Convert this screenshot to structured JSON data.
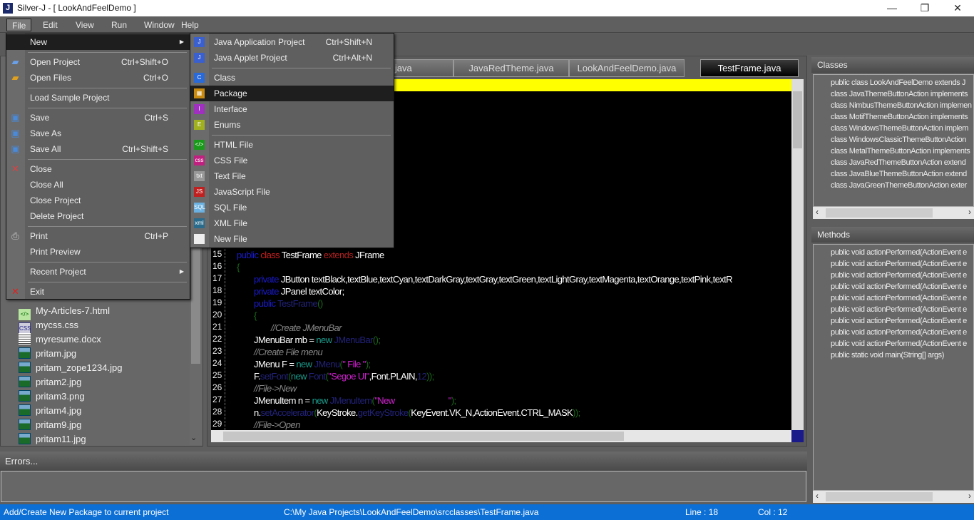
{
  "window": {
    "title": "Silver-J - [ LookAndFeelDemo ]",
    "app_icon": "J",
    "controls": [
      "—",
      "❐",
      "✕"
    ]
  },
  "menubar": [
    "File",
    "Edit",
    "View",
    "Run",
    "Window",
    "Help"
  ],
  "file_menu": [
    {
      "label": "New",
      "shortcut": "",
      "submenu": true,
      "icon": "none"
    },
    {
      "sep": true
    },
    {
      "label": "Open Project",
      "shortcut": "Ctrl+Shift+O",
      "icon": "folder-open-icon"
    },
    {
      "label": "Open Files",
      "shortcut": "Ctrl+O",
      "icon": "folder-icon"
    },
    {
      "sep": true
    },
    {
      "label": "Load Sample Project",
      "shortcut": ""
    },
    {
      "sep": true
    },
    {
      "label": "Save",
      "shortcut": "Ctrl+S",
      "icon": "save-icon"
    },
    {
      "label": "Save As",
      "shortcut": "",
      "icon": "save-as-icon"
    },
    {
      "label": "Save All",
      "shortcut": "Ctrl+Shift+S",
      "icon": "save-all-icon"
    },
    {
      "sep": true
    },
    {
      "label": "Close",
      "shortcut": "",
      "icon": "close-file-icon"
    },
    {
      "label": "Close All",
      "shortcut": ""
    },
    {
      "label": "Close Project",
      "shortcut": ""
    },
    {
      "label": "Delete Project",
      "shortcut": ""
    },
    {
      "sep": true
    },
    {
      "label": "Print",
      "shortcut": "Ctrl+P",
      "icon": "printer-icon"
    },
    {
      "label": "Print Preview",
      "shortcut": ""
    },
    {
      "sep": true
    },
    {
      "label": "Recent Project",
      "shortcut": "",
      "submenu": true
    },
    {
      "sep": true
    },
    {
      "label": "Exit",
      "shortcut": "",
      "icon": "exit-icon"
    }
  ],
  "new_submenu": [
    {
      "label": "Java Application Project",
      "shortcut": "Ctrl+Shift+N",
      "icon": "java-project-icon",
      "glyph": "J",
      "color": "#3a5fcf"
    },
    {
      "label": "Java Applet Project",
      "shortcut": "Ctrl+Alt+N",
      "icon": "java-applet-icon",
      "glyph": "J",
      "color": "#3a5fcf"
    },
    {
      "sep": true
    },
    {
      "label": "Class",
      "shortcut": "",
      "icon": "class-icon",
      "glyph": "C",
      "color": "#2a6ad8"
    },
    {
      "label": "Package",
      "shortcut": "",
      "icon": "package-icon",
      "glyph": "▦",
      "color": "#c88a10",
      "highlighted": true
    },
    {
      "label": "Interface",
      "shortcut": "",
      "icon": "interface-icon",
      "glyph": "I",
      "color": "#a030c0"
    },
    {
      "label": "Enums",
      "shortcut": "",
      "icon": "enum-icon",
      "glyph": "E",
      "color": "#a0b020"
    },
    {
      "sep": true
    },
    {
      "label": "HTML File",
      "shortcut": "",
      "icon": "html-file-icon",
      "glyph": "</>",
      "color": "#1a9a1a"
    },
    {
      "label": "CSS File",
      "shortcut": "",
      "icon": "css-file-icon",
      "glyph": "css",
      "color": "#c02080"
    },
    {
      "label": "Text File",
      "shortcut": "",
      "icon": "text-file-icon",
      "glyph": "txt",
      "color": "#999"
    },
    {
      "label": "JavaScript File",
      "shortcut": "",
      "icon": "js-file-icon",
      "glyph": "JS",
      "color": "#c02020"
    },
    {
      "label": "SQL File",
      "shortcut": "",
      "icon": "sql-file-icon",
      "glyph": "SQL",
      "color": "#6ab0e0"
    },
    {
      "label": "XML File",
      "shortcut": "",
      "icon": "xml-file-icon",
      "glyph": "xml",
      "color": "#2a6a8a"
    },
    {
      "label": "New File",
      "shortcut": "",
      "icon": "new-file-icon",
      "glyph": "",
      "color": "#eee"
    }
  ],
  "tree": [
    {
      "name": "My-Articles-7.html",
      "type": "html"
    },
    {
      "name": "mycss.css",
      "type": "css"
    },
    {
      "name": "myresume.docx",
      "type": "doc"
    },
    {
      "name": "pritam.jpg",
      "type": "img"
    },
    {
      "name": "pritam_zope1234.jpg",
      "type": "img"
    },
    {
      "name": "pritam2.jpg",
      "type": "img"
    },
    {
      "name": "pritam3.png",
      "type": "img"
    },
    {
      "name": "pritam4.jpg",
      "type": "img"
    },
    {
      "name": "pritam9.jpg",
      "type": "img"
    },
    {
      "name": "pritam11.jpg",
      "type": "img"
    }
  ],
  "tabs": [
    {
      "label": "me.java"
    },
    {
      "label": "JavaRedTheme.java"
    },
    {
      "label": "LookAndFeelDemo.java"
    },
    {
      "label": "TestFrame.java",
      "active": true
    }
  ],
  "code": [
    {
      "n": "15",
      "indent": 0,
      "tokens": [
        [
          "public ",
          "#1a1acc"
        ],
        [
          "class ",
          "#cc2020"
        ],
        [
          "TestFrame ",
          "#fff"
        ],
        [
          "extends ",
          "#b02020"
        ],
        [
          "JFrame",
          "#fff"
        ]
      ]
    },
    {
      "n": "16",
      "indent": 0,
      "tokens": [
        [
          "{",
          "#1a6a1a"
        ]
      ]
    },
    {
      "n": "17",
      "indent": 1,
      "tokens": [
        [
          "private ",
          "#1a1acc"
        ],
        [
          "JButton textBlack,textBlue,textCyan,textDarkGray,textGray,textGreen,textLightGray,textMagenta,textOrange,textPink,textR",
          "#fff"
        ]
      ]
    },
    {
      "n": "18",
      "indent": 1,
      "tokens": [
        [
          "private ",
          "#1a1acc"
        ],
        [
          "JPanel textColor;",
          "#fff"
        ]
      ]
    },
    {
      "n": "19",
      "indent": 1,
      "tokens": [
        [
          "public ",
          "#1a1acc"
        ],
        [
          "TestFrame",
          "#22227a"
        ],
        [
          "()",
          "#1a6a1a"
        ]
      ]
    },
    {
      "n": "20",
      "indent": 1,
      "tokens": [
        [
          "{",
          "#1a6a1a"
        ]
      ]
    },
    {
      "n": "21",
      "indent": 2,
      "tokens": [
        [
          "//Create JMenuBar",
          "#888",
          "i"
        ]
      ]
    },
    {
      "n": "22",
      "indent": 1,
      "tokens": [
        [
          "JMenuBar mb = ",
          "#fff"
        ],
        [
          "new ",
          "#1a9a8a"
        ],
        [
          "JMenuBar",
          "#22227a"
        ],
        [
          "();",
          "#1a6a1a"
        ]
      ]
    },
    {
      "n": "23",
      "indent": 1,
      "tokens": [
        [
          "//Create File menu",
          "#888",
          "i"
        ]
      ]
    },
    {
      "n": "24",
      "indent": 1,
      "tokens": [
        [
          "JMenu F = ",
          "#fff"
        ],
        [
          "new ",
          "#1a9a8a"
        ],
        [
          "JMenu",
          "#22227a"
        ],
        [
          "(",
          "#1a6a1a"
        ],
        [
          "\" File \"",
          "#d020d0"
        ],
        [
          ");",
          "#1a6a1a"
        ]
      ]
    },
    {
      "n": "25",
      "indent": 1,
      "tokens": [
        [
          "F.",
          "#fff"
        ],
        [
          "setFont",
          "#22227a"
        ],
        [
          "(",
          "#1a6a1a"
        ],
        [
          "new ",
          "#1a9a8a"
        ],
        [
          "Font",
          "#22227a"
        ],
        [
          "(",
          "#1a6a1a"
        ],
        [
          "\"Segoe UI\"",
          "#d020d0"
        ],
        [
          ",Font.PLAIN,",
          "#fff"
        ],
        [
          "12",
          "#22227a"
        ],
        [
          "));",
          "#1a6a1a"
        ]
      ]
    },
    {
      "n": "26",
      "indent": 1,
      "tokens": [
        [
          "//File->New",
          "#888",
          "i"
        ]
      ]
    },
    {
      "n": "27",
      "indent": 1,
      "tokens": [
        [
          "JMenuItem n = ",
          "#fff"
        ],
        [
          "new ",
          "#1a9a8a"
        ],
        [
          "JMenuItem",
          "#22227a"
        ],
        [
          "(",
          "#1a6a1a"
        ],
        [
          "\"New                         \"",
          "#d020d0"
        ],
        [
          ");",
          "#1a6a1a"
        ]
      ]
    },
    {
      "n": "28",
      "indent": 1,
      "tokens": [
        [
          "n.",
          "#fff"
        ],
        [
          "setAccelerator",
          "#22227a"
        ],
        [
          "(",
          "#1a6a1a"
        ],
        [
          "KeyStroke.",
          "#fff"
        ],
        [
          "getKeyStroke",
          "#22227a"
        ],
        [
          "(",
          "#1a6a1a"
        ],
        [
          "KeyEvent.VK_N,ActionEvent.CTRL_MASK",
          "#fff"
        ],
        [
          "));",
          "#1a6a1a"
        ]
      ]
    },
    {
      "n": "29",
      "indent": 1,
      "tokens": [
        [
          "//File->Open",
          "#888",
          "i"
        ]
      ]
    }
  ],
  "classes": {
    "title": "Classes",
    "items": [
      "public class LookAndFeelDemo extends J",
      "class JavaThemeButtonAction implements",
      "class NimbusThemeButtonAction implemen",
      "class MotifThemeButtonAction implements",
      "class WindowsThemeButtonAction implem",
      "class WindowsClassicThemeButtonAction",
      "class MetalThemeButtonAction implements",
      "class JavaRedThemeButtonAction extend",
      "class JavaBlueThemeButtonAction extend",
      "class JavaGreenThemeButtonAction exter"
    ]
  },
  "methods": {
    "title": "Methods",
    "items": [
      "public void actionPerformed(ActionEvent e",
      "public void actionPerformed(ActionEvent e",
      "public void actionPerformed(ActionEvent e",
      "public void actionPerformed(ActionEvent e",
      "public void actionPerformed(ActionEvent e",
      "public void actionPerformed(ActionEvent e",
      "public void actionPerformed(ActionEvent e",
      "public void actionPerformed(ActionEvent e",
      "public void actionPerformed(ActionEvent e",
      "public static void main(String[] args)"
    ]
  },
  "errors": {
    "title": "Errors..."
  },
  "status": {
    "message": "Add/Create New Package to current project",
    "path": "C:\\My Java Projects\\LookAndFeelDemo\\srcclasses\\TestFrame.java",
    "line": "Line : 18",
    "col": "Col : 12"
  },
  "colors": {
    "status_bar": "#0b6fd6",
    "highlight_line": "#ffff00",
    "editor_bg": "#000000"
  }
}
